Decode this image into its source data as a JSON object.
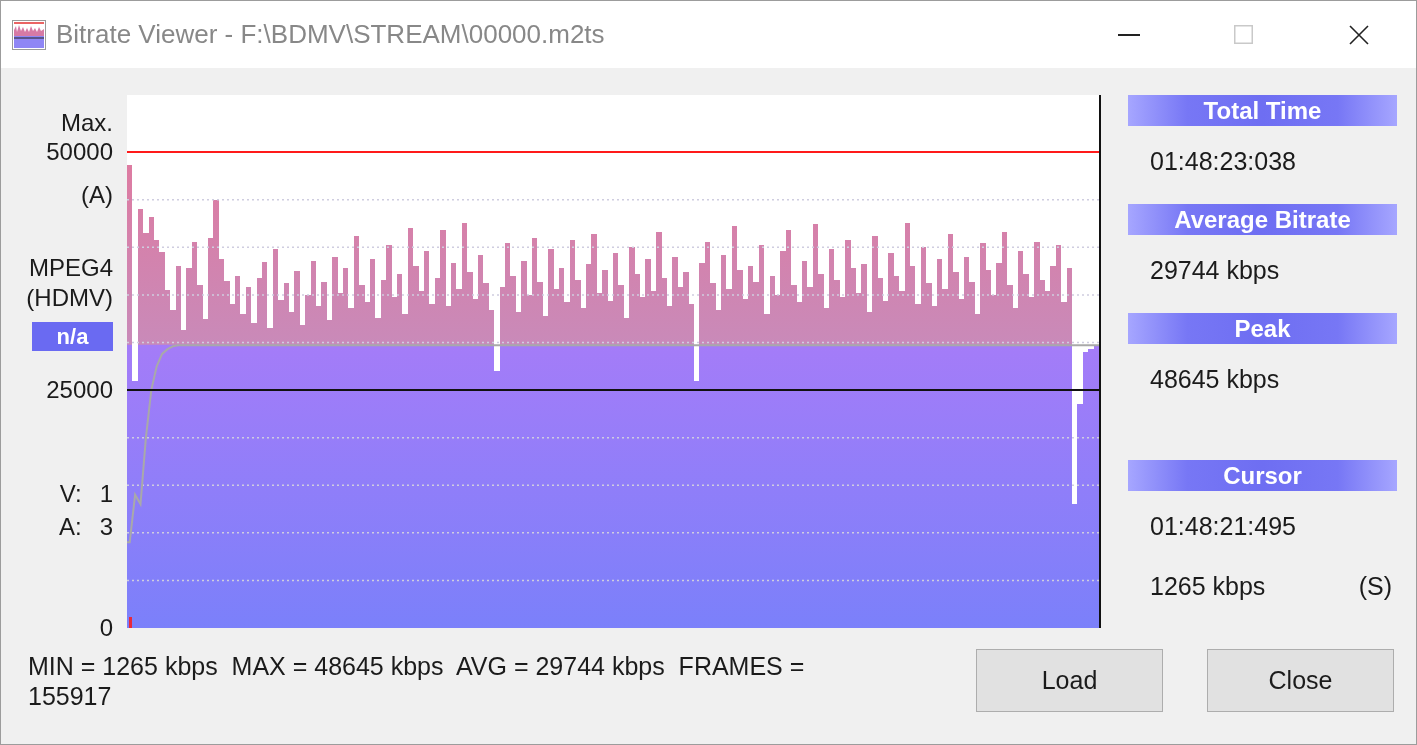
{
  "window": {
    "title": "Bitrate Viewer - F:\\BDMV\\STREAM\\00000.m2ts",
    "controls": [
      {
        "kind": "minimize",
        "disabled": false
      },
      {
        "kind": "maximize",
        "disabled": true
      },
      {
        "kind": "close",
        "disabled": false
      }
    ]
  },
  "axis_panel": {
    "max_label": "Max.",
    "mode": "(A)",
    "format": "MPEG4",
    "format_detail": "(HDMV)",
    "badge": "n/a",
    "streams": [
      {
        "label": "V:",
        "count": "1"
      },
      {
        "label": "A:",
        "count": "3"
      }
    ]
  },
  "chart": {
    "chart_data": {
      "type": "bar",
      "ylim": [
        0,
        56000
      ],
      "yticks": [
        {
          "value": 50000,
          "label": "50000"
        },
        {
          "value": 25000,
          "label": "25000"
        },
        {
          "value": 0,
          "label": "0"
        }
      ],
      "ref_lines": [
        {
          "axis": "y",
          "value": 50000,
          "color": "#ff1a1a"
        },
        {
          "axis": "y",
          "value": 25000,
          "color": "#111111"
        }
      ],
      "series": [
        {
          "values": [
            48600,
            26000,
            44000,
            41500,
            43200,
            40800,
            39500,
            35500,
            33400,
            38000,
            31300,
            37800,
            40600,
            36000,
            32500,
            41000,
            45000,
            38800,
            36500,
            34000,
            37000,
            33000,
            35800,
            32000,
            36800,
            38500,
            31500,
            39800,
            34500,
            36200,
            33200,
            37500,
            31800,
            35000,
            38600,
            33800,
            36400,
            32400,
            39000,
            35200,
            37800,
            33600,
            41200,
            36000,
            34200,
            38800,
            32600,
            36600,
            40200,
            34800,
            37200,
            33000,
            42000,
            38000,
            35400,
            39600,
            34000,
            36800,
            41800,
            33800,
            38400,
            35600,
            42600,
            37400,
            34600,
            39200,
            36200,
            33400,
            27000,
            35800,
            40400,
            37000,
            33200,
            38600,
            35000,
            41000,
            36400,
            32800,
            39800,
            35600,
            37800,
            34200,
            40800,
            36600,
            33600,
            38200,
            41400,
            35200,
            37600,
            34400,
            39400,
            36000,
            32600,
            40000,
            37200,
            34800,
            38800,
            35400,
            41600,
            36800,
            33800,
            39000,
            35800,
            37400,
            34000,
            26000,
            38400,
            40600,
            36200,
            33400,
            39200,
            35600,
            42200,
            37600,
            34600,
            38000,
            36400,
            40200,
            33000,
            37000,
            35000,
            39600,
            41800,
            36000,
            34200,
            38600,
            35800,
            42400,
            37200,
            33600,
            39800,
            36600,
            34800,
            40800,
            37800,
            35200,
            38200,
            33200,
            41200,
            36800,
            34400,
            39400,
            37000,
            35400,
            42600,
            38000,
            34000,
            40000,
            36200,
            33800,
            38800,
            35600,
            41400,
            37400,
            34600,
            39000,
            36400,
            33000,
            40400,
            37600,
            35000,
            38400,
            41600,
            36000,
            33600,
            39600,
            37200,
            34800,
            40600,
            36600,
            35400,
            38000,
            40200,
            34200,
            37800,
            13000,
            23500,
            29000,
            29300,
            29600
          ]
        },
        {
          "type": "line",
          "color": "#a9a9a9",
          "values": [
            9000,
            14000,
            13000,
            20000,
            25000,
            27500,
            28800,
            29300,
            29600,
            29700,
            29700,
            29700,
            29700,
            29700,
            29700,
            29700,
            29700,
            29700,
            29700,
            29700,
            29700,
            29700,
            29700,
            29700,
            29700,
            29700,
            29700,
            29700,
            29700,
            29700,
            29700,
            29700,
            29700,
            29700,
            29700,
            29700,
            29700,
            29700,
            29700,
            29700,
            29700,
            29700,
            29700,
            29700,
            29700,
            29700,
            29700,
            29700,
            29700,
            29700,
            29700,
            29700,
            29700,
            29700,
            29700,
            29700,
            29700,
            29700,
            29700,
            29700,
            29700,
            29700,
            29700,
            29700,
            29700,
            29700,
            29700,
            29700,
            29700,
            29700,
            29700,
            29700,
            29700,
            29700,
            29700,
            29700,
            29700,
            29700,
            29700,
            29700,
            29700,
            29700,
            29700,
            29700,
            29700,
            29700,
            29700,
            29700,
            29700,
            29700,
            29700,
            29700,
            29700,
            29700,
            29700,
            29700,
            29700,
            29700,
            29700,
            29700,
            29700,
            29700,
            29700,
            29700,
            29700,
            29700,
            29700,
            29700,
            29700,
            29700,
            29700,
            29700,
            29700,
            29700,
            29700,
            29700,
            29700,
            29700,
            29700,
            29700,
            29700,
            29700,
            29700,
            29700,
            29700,
            29700,
            29700,
            29700,
            29700,
            29700,
            29700,
            29700,
            29700,
            29700,
            29700,
            29700,
            29700,
            29700,
            29700,
            29700,
            29700,
            29700,
            29700,
            29700,
            29700,
            29700,
            29700,
            29700,
            29700,
            29700,
            29700,
            29700,
            29700,
            29700,
            29700,
            29700,
            29700,
            29700,
            29700,
            29700,
            29700,
            29700,
            29700,
            29700,
            29700,
            29700,
            29700,
            29700,
            29700,
            29700,
            29700,
            29700,
            29700,
            29700,
            29700,
            29700,
            29700,
            29700,
            29700,
            29700
          ]
        }
      ]
    }
  },
  "info_panel": {
    "sections": [
      {
        "title": "Total Time",
        "lines": [
          {
            "text": "01:48:23:038"
          }
        ]
      },
      {
        "title": "Average Bitrate",
        "lines": [
          {
            "text": "29744 kbps"
          }
        ]
      },
      {
        "title": "Peak",
        "lines": [
          {
            "text": "48645 kbps"
          }
        ]
      },
      {
        "title": "Cursor",
        "lines": [
          {
            "text": "01:48:21:495"
          },
          {
            "text": "1265 kbps",
            "suffix": "(S)"
          }
        ]
      }
    ]
  },
  "stats": "MIN = 1265 kbps  MAX = 48645 kbps  AVG = 29744 kbps  FRAMES = 155917",
  "buttons": [
    {
      "label": "Load"
    },
    {
      "label": "Close"
    }
  ]
}
